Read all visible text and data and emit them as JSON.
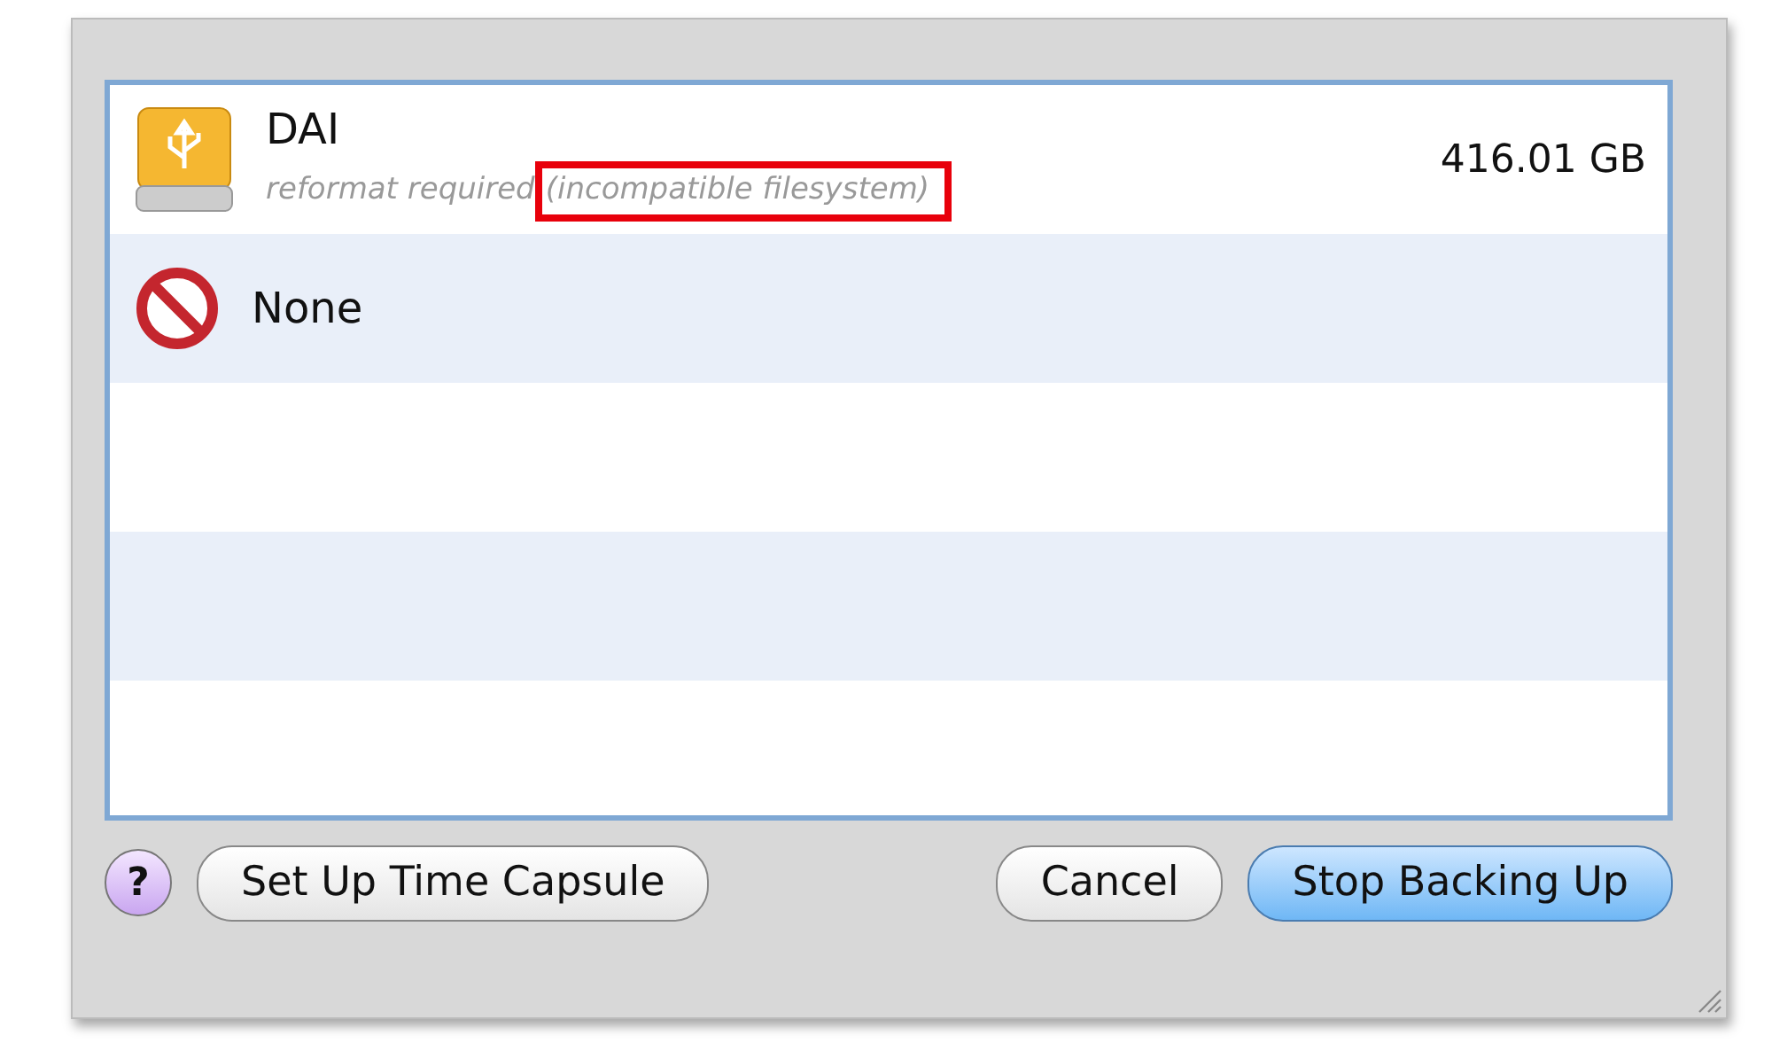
{
  "disks": [
    {
      "kind": "usb-drive",
      "name": "DAI",
      "status": "reformat required",
      "highlighted_note": "(incompatible filesystem)",
      "size": "416.01 GB"
    },
    {
      "kind": "none",
      "name": "None"
    }
  ],
  "buttons": [
    {
      "kind": "help",
      "label": "?"
    },
    {
      "kind": "normal",
      "label": "Set Up Time Capsule"
    },
    {
      "kind": "normal",
      "label": "Cancel"
    },
    {
      "kind": "default",
      "label": "Stop Backing Up"
    }
  ]
}
